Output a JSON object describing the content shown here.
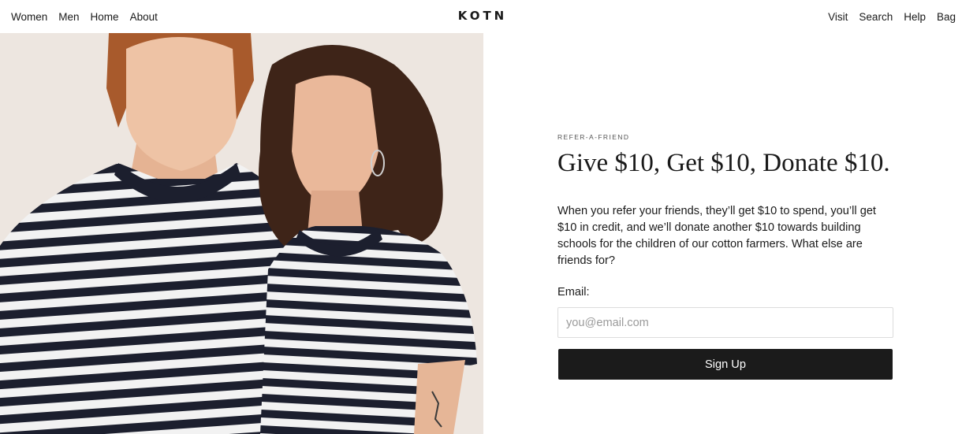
{
  "header": {
    "nav_left": [
      "Women",
      "Men",
      "Home",
      "About"
    ],
    "logo": "KOTN",
    "nav_right": [
      "Visit",
      "Search",
      "Help",
      "Bag"
    ]
  },
  "hero": {
    "image_label": "hero-image"
  },
  "main": {
    "eyebrow": "REFER-A-FRIEND",
    "headline": "Give $10, Get $10, Donate $10.",
    "body": "When you refer your friends, they’ll get $10 to spend, you’ll get $10 in credit, and we’ll donate another $10 towards building schools for the children of our cotton farmers. What else are friends for?",
    "email_label": "Email:",
    "email_placeholder": "you@email.com",
    "signup_label": "Sign Up"
  },
  "colors": {
    "background": "#ffffff",
    "text": "#1a1a1a",
    "button_bg": "#1b1b1b",
    "button_text": "#ffffff",
    "stripe_dark": "#1c1f2e",
    "photo_backdrop": "#ede6e0"
  }
}
